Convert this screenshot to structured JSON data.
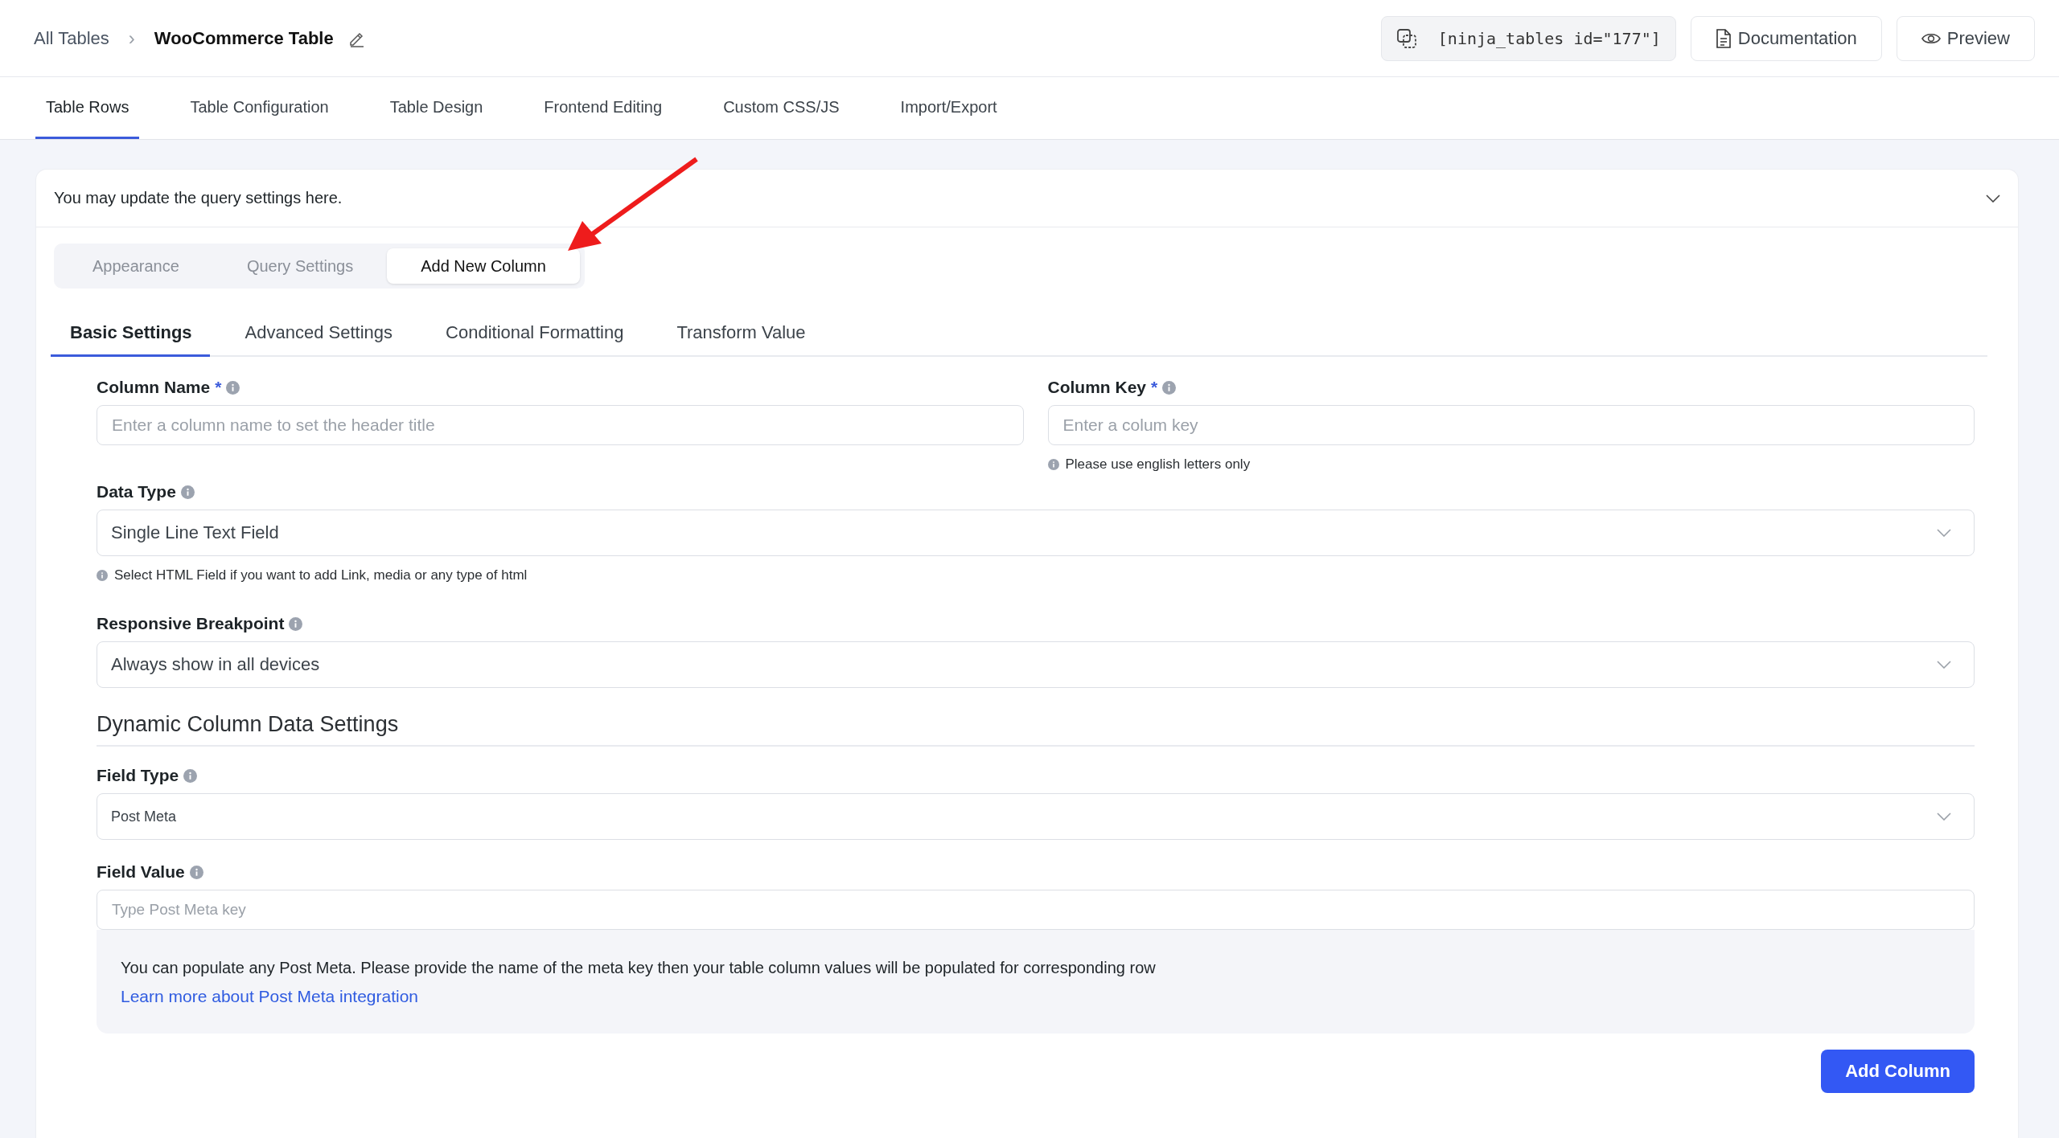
{
  "breadcrumb": {
    "parent": "All Tables",
    "separator": "›",
    "current": "WooCommerce Table"
  },
  "shortcode": "[ninja_tables id=\"177\"]",
  "header_buttons": [
    {
      "kind": "docs",
      "label": "Documentation"
    },
    {
      "kind": "preview",
      "label": "Preview"
    }
  ],
  "main_tabs": [
    {
      "label": "Table Rows",
      "selected": true
    },
    {
      "label": "Table Configuration",
      "selected": false
    },
    {
      "label": "Table Design",
      "selected": false
    },
    {
      "label": "Frontend Editing",
      "selected": false
    },
    {
      "label": "Custom CSS/JS",
      "selected": false
    },
    {
      "label": "Import/Export",
      "selected": false
    }
  ],
  "card": {
    "header": "You may update the query settings here.",
    "expanded": true
  },
  "segment_tabs": [
    {
      "label": "Appearance",
      "selected": false
    },
    {
      "label": "Query Settings",
      "selected": false
    },
    {
      "label": "Add New Column",
      "selected": true
    }
  ],
  "sub_tabs": [
    {
      "label": "Basic Settings",
      "selected": true
    },
    {
      "label": "Advanced Settings",
      "selected": false
    },
    {
      "label": "Conditional Formatting",
      "selected": false
    },
    {
      "label": "Transform Value",
      "selected": false
    }
  ],
  "basic_row": [
    {
      "kind": "input",
      "label": "Column Name",
      "required_mark": "*",
      "placeholder": "Enter a column name to set the header title"
    },
    {
      "kind": "input",
      "label": "Column Key",
      "required_mark": "*",
      "placeholder": "Enter a colum key",
      "hint": "Please use english letters only"
    }
  ],
  "basic_fields": [
    {
      "kind": "select",
      "label": "Data Type",
      "value": "Single Line Text Field",
      "hint": "Select HTML Field if you want to add Link, media or any type of html"
    },
    {
      "kind": "select",
      "label": "Responsive Breakpoint",
      "value": "Always show in all devices"
    }
  ],
  "dynamic": {
    "title": "Dynamic Column Data Settings",
    "fields": [
      {
        "kind": "select",
        "label": "Field Type",
        "value": "Post Meta"
      },
      {
        "kind": "input",
        "label": "Field Value",
        "placeholder": "Type Post Meta key"
      }
    ],
    "note": "You can populate any Post Meta. Please provide the name of the meta key then your table column values will be populated for corresponding row",
    "link": "Learn more about Post Meta integration"
  },
  "submit": "Add Column"
}
